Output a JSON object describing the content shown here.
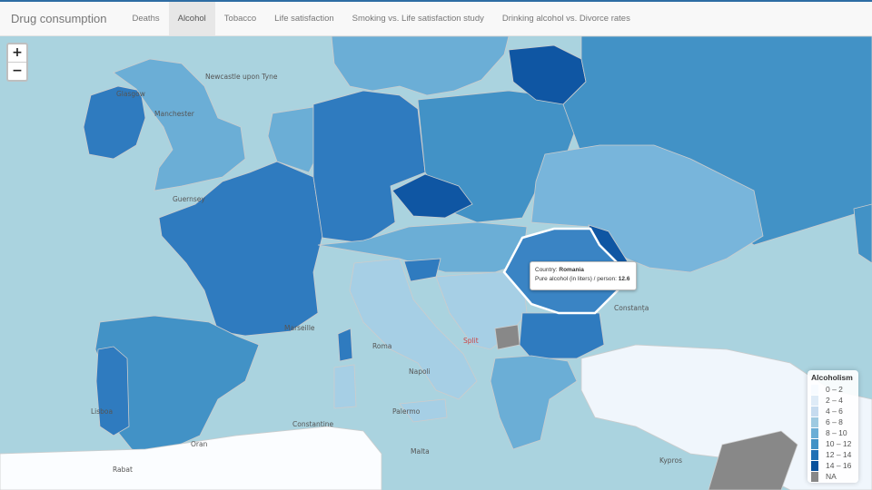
{
  "navbar": {
    "brand": "Drug consumption",
    "tabs": [
      {
        "label": "Deaths"
      },
      {
        "label": "Alcohol"
      },
      {
        "label": "Tobacco"
      },
      {
        "label": "Life satisfaction"
      },
      {
        "label": "Smoking vs. Life satisfaction study"
      },
      {
        "label": "Drinking alcohol vs. Divorce rates"
      }
    ],
    "active_tab": "Alcohol"
  },
  "zoom": {
    "in_label": "+",
    "out_label": "−"
  },
  "cities": [
    "Newcastle upon Tyne",
    "Glasgow",
    "Manchester",
    "Guernsey",
    "Marseille",
    "Roma",
    "Napoli",
    "Palermo",
    "Constantine",
    "Oran",
    "Rabat",
    "Malta",
    "Constanța",
    "Kypros",
    "Lisboa",
    "Split"
  ],
  "tooltip": {
    "country_label": "Country:",
    "country": "Romania",
    "value_label": "Pure alcohol (in liters) / person:",
    "value": "12.6"
  },
  "legend": {
    "title": "Alcoholism",
    "items": [
      {
        "label": "0 – 2",
        "color": "#f7fbff"
      },
      {
        "label": "2 – 4",
        "color": "#deebf7"
      },
      {
        "label": "4 – 6",
        "color": "#c6dbef"
      },
      {
        "label": "6 – 8",
        "color": "#9ecae1"
      },
      {
        "label": "8 – 10",
        "color": "#6baed6"
      },
      {
        "label": "10 – 12",
        "color": "#4292c6"
      },
      {
        "label": "12 – 14",
        "color": "#2171b5"
      },
      {
        "label": "14 – 16",
        "color": "#08519c"
      },
      {
        "label": "NA",
        "color": "#888888"
      }
    ]
  }
}
